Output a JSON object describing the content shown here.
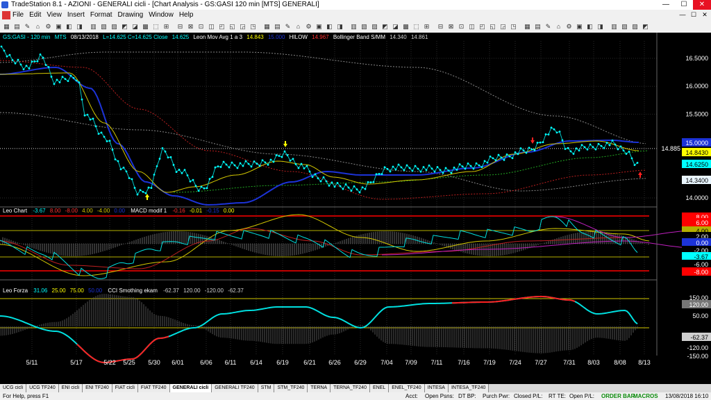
{
  "window": {
    "title": "TradeStation 8.1 - AZIONI - GENERALI cicli - [Chart Analysis - GS:GASI  120 min  [MTS] GENERALI]",
    "minimize": "—",
    "maximize": "☐",
    "close": "✕"
  },
  "menu": {
    "items": [
      "File",
      "Edit",
      "View",
      "Insert",
      "Format",
      "Drawing",
      "Window",
      "Help"
    ]
  },
  "price_header": {
    "symbol": "GS:GASI - 120 min",
    "mts": "MTS",
    "date": "08/13/2018",
    "ohlc": "L=14.625  C=14.625  Close",
    "close_val": "14.625",
    "ind1": "Leon Mov Avg 1 a 3",
    "ind1_v1": "14.843",
    "ind1_v2": "15.000",
    "ind2": "HILOW",
    "ind2_v": "14.967",
    "ind3": "Bollinger Band S/MM",
    "ind3_v1": "14.340",
    "ind3_v2": "14.861"
  },
  "macd_header": {
    "name": "Leo Chart",
    "v1": "-3.67",
    "v2": "8.00",
    "v3": "-8.00",
    "v4": "4.00",
    "v5": "-4.00",
    "v6": "0.00",
    "ind": "MACD modif 1",
    "m1": "-0.16",
    "m2": "-0.01",
    "m3": "-0.15",
    "m4": "0.00"
  },
  "cci_header": {
    "name": "Leo Forza",
    "v1": "31.06",
    "v2": "25.00",
    "v3": "75.00",
    "v4": "50.00",
    "ind": "CCI Smothing ekam",
    "c1": "-62.37",
    "c2": "120.00",
    "c3": "-120.00",
    "c4": "-62.37"
  },
  "price_axis": {
    "ticks": [
      "16.5000",
      "16.0000",
      "15.5000",
      "14.0000"
    ],
    "last_line": "14.885",
    "labels": [
      {
        "text": "15.0000",
        "bg": "#1c33d8",
        "fg": "#ffffff"
      },
      {
        "text": "14.8430",
        "bg": "#ffff00",
        "fg": "#000000"
      },
      {
        "text": "14.6250",
        "bg": "#00ffff",
        "fg": "#000000"
      },
      {
        "text": "14.3400",
        "bg": "#e9f6ff",
        "fg": "#000000"
      }
    ]
  },
  "macd_axis": {
    "labels": [
      {
        "text": "8.00",
        "bg": "#ff0000",
        "fg": "#ffffff"
      },
      {
        "text": "6.00",
        "bg": "#ff0000",
        "fg": "#ffffff"
      },
      {
        "text": "4.00",
        "bg": "#b5b000",
        "fg": "#000000"
      },
      {
        "text": "2.00",
        "bg": "#000000",
        "fg": "#ffffff"
      },
      {
        "text": "0.00",
        "bg": "#1c33d8",
        "fg": "#ffffff"
      },
      {
        "text": "-2.00",
        "bg": "#000000",
        "fg": "#ffffff"
      },
      {
        "text": "-3.67",
        "bg": "#00ffff",
        "fg": "#000000"
      },
      {
        "text": "-6.00",
        "bg": "#000000",
        "fg": "#ffffff"
      },
      {
        "text": "-8.00",
        "bg": "#ff0000",
        "fg": "#ffffff"
      }
    ]
  },
  "cci_axis": {
    "labels": [
      {
        "text": "150.00",
        "bg": "#000000",
        "fg": "#ffffff"
      },
      {
        "text": "120.00",
        "bg": "#777777",
        "fg": "#ffffff"
      },
      {
        "text": "50.00",
        "bg": "#000000",
        "fg": "#ffffff"
      },
      {
        "text": "-62.37",
        "bg": "#cfcfcf",
        "fg": "#000000"
      },
      {
        "text": "-120.00",
        "bg": "#000000",
        "fg": "#ffffff"
      },
      {
        "text": "-150.00",
        "bg": "#000000",
        "fg": "#ffffff"
      }
    ]
  },
  "x_axis": {
    "dates": [
      "5/11",
      "5/17",
      "5/22",
      "5/25",
      "5/30",
      "6/01",
      "6/06",
      "6/11",
      "6/14",
      "6/19",
      "6/21",
      "6/26",
      "6/29",
      "7/04",
      "7/09",
      "7/11",
      "7/16",
      "7/19",
      "7/24",
      "7/27",
      "7/31",
      "8/03",
      "8/08",
      "8/13"
    ]
  },
  "tabs": [
    "UCG cicli",
    "UCG TF240",
    "ENI cicli",
    "ENI TF240",
    "FIAT cicli",
    "FIAT TF240",
    "GENERALI cicli",
    "GENERALI TF240",
    "STM",
    "STM_TF240",
    "TERNA",
    "TERNA_TF240",
    "ENEL",
    "ENEL_TF240",
    "INTESA",
    "INTESA_TF240"
  ],
  "active_tab": "GENERALI cicli",
  "status": {
    "help": "For Help, press F1",
    "acct": "Acct:",
    "open_psns": "Open Psns:",
    "dt_bp": "DT BP:",
    "purch_pwr": "Purch Pwr:",
    "closed_pl": "Closed P/L:",
    "rt_te": "RT TE:",
    "open_pl": "Open P/L:",
    "order_bar": "ORDER BAR",
    "macros": "MACROS",
    "datetime": "13/08/2018 16:10"
  },
  "colors": {
    "close": "#00ffff",
    "ma_fast": "#1c33d8",
    "ma_slow": "#d4c800",
    "bollinger": "#888888",
    "hilow": "#c02020",
    "macd_band": "#ff0000",
    "cci": "#00e0e0",
    "cci_hot": "#ff2020"
  }
}
